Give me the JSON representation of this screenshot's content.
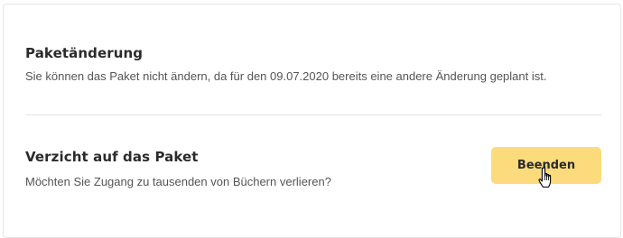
{
  "package_change": {
    "title": "Paketänderung",
    "description": "Sie können das Paket nicht ändern, da für den 09.07.2020 bereits eine andere Änderung geplant ist."
  },
  "cancel_package": {
    "title": "Verzicht auf das Paket",
    "description": "Möchten Sie Zugang zu tausenden von Büchern verlieren?",
    "button_label": "Beenden"
  },
  "colors": {
    "button_bg": "#fbdb7c",
    "divider": "#e3e3e3"
  },
  "icons": {
    "cursor": "hand-pointer-icon"
  }
}
